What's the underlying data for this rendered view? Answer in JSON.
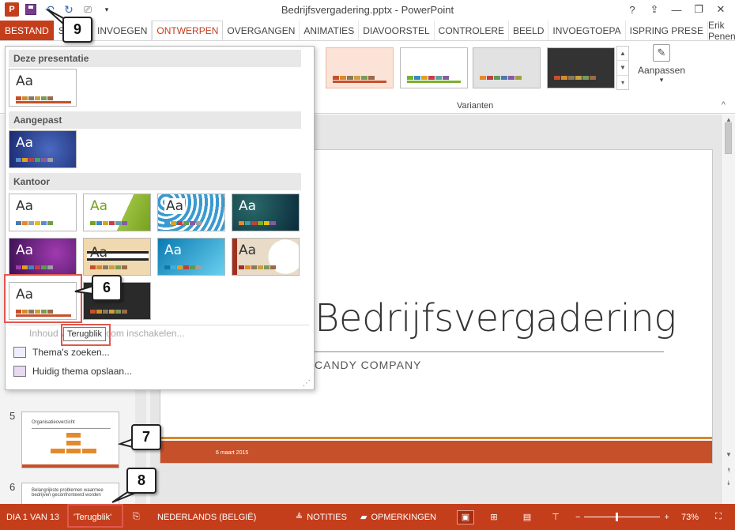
{
  "window": {
    "title": "Bedrijfsvergadering.pptx - PowerPoint",
    "help": "?",
    "minimize": "—",
    "restore": "❐",
    "close": "✕"
  },
  "qat": {
    "logo": "P",
    "undo": "↶",
    "redo": "↻",
    "more": "▾"
  },
  "tabs": [
    {
      "label": "BESTAND",
      "type": "file"
    },
    {
      "label": "START",
      "type": "normal"
    },
    {
      "label": "INVOEGEN",
      "type": "normal"
    },
    {
      "label": "ONTWERPEN",
      "type": "active"
    },
    {
      "label": "OVERGANGEN",
      "type": "normal"
    },
    {
      "label": "ANIMATIES",
      "type": "normal"
    },
    {
      "label": "DIAVOORSTEL",
      "type": "normal"
    },
    {
      "label": "CONTROLERE",
      "type": "normal"
    },
    {
      "label": "BEELD",
      "type": "normal"
    },
    {
      "label": "INVOEGTOEPA",
      "type": "normal"
    },
    {
      "label": "ISPRING PRESE",
      "type": "normal"
    }
  ],
  "user": {
    "name": "Erik Penen",
    "caret": "▾"
  },
  "ribbon": {
    "variants_label": "Varianten",
    "customize_label": "Aanpassen",
    "customize_caret": "▾",
    "collapse": "^"
  },
  "dropdown": {
    "sections": [
      "Deze presentatie",
      "Aangepast",
      "Kantoor"
    ],
    "aa": "Aa",
    "menu": {
      "enable_content": "Inhoud van Office.com inschakelen...",
      "browse": "Thema's zoeken...",
      "save": "Huidig thema opslaan..."
    },
    "tooltip": "Terugblik"
  },
  "slide": {
    "title": "Bedrijfsvergadering",
    "subtitle": "CANDY COMPANY",
    "date": "6 maart 2015"
  },
  "thumbnails": [
    {
      "num": "5",
      "title": "Organisatieoverzicht"
    },
    {
      "num": "6",
      "title": "Belangrijkste problemen waarmee bedrijven geconfronteerd worden"
    }
  ],
  "statusbar": {
    "slide": "DIA 1 VAN 13",
    "theme": "'Terugblik'",
    "language": "NEDERLANDS (BELGIË)",
    "notes": "NOTITIES",
    "comments": "OPMERKINGEN",
    "zoom_minus": "−",
    "zoom_plus": "+",
    "zoom": "73%"
  },
  "callouts": [
    "9",
    "6",
    "7",
    "8"
  ],
  "colors": {
    "accent": "#c43e1c",
    "slide_band": "#c5502a",
    "highlight": "#e0574f"
  }
}
